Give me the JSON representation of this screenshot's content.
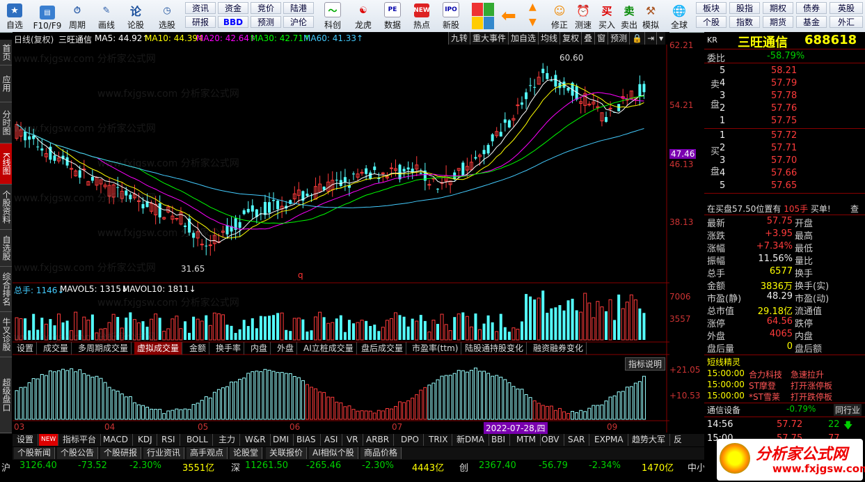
{
  "toolbar": {
    "buttons": [
      {
        "label": "自选",
        "icon": "star-icon"
      },
      {
        "label": "F10/F9",
        "icon": "f10-icon"
      },
      {
        "label": "周期",
        "icon": "period-icon"
      },
      {
        "label": "画线",
        "icon": "draw-line-icon"
      },
      {
        "label": "论股",
        "icon": "discuss-icon"
      },
      {
        "label": "选股",
        "icon": "stock-picker-icon"
      }
    ],
    "grid1": [
      "资讯",
      "资金",
      "竞价",
      "陆港",
      "研报",
      "BBD",
      "预测",
      "沪伦"
    ],
    "buttons2": [
      {
        "label": "科创",
        "icon": "kechuang-icon"
      },
      {
        "label": "龙虎",
        "icon": "dragon-tiger-icon"
      },
      {
        "label": "数据",
        "icon": "pe-data-icon"
      },
      {
        "label": "热点",
        "icon": "hot-icon"
      },
      {
        "label": "新股",
        "icon": "ipo-icon"
      }
    ],
    "buttons3": [
      {
        "label": "修正",
        "icon": "correct-icon"
      },
      {
        "label": "测速",
        "icon": "speed-test-icon"
      },
      {
        "label": "买入",
        "icon": "buy-icon",
        "glyph": "买"
      },
      {
        "label": "卖出",
        "icon": "sell-icon",
        "glyph": "卖"
      },
      {
        "label": "模拟",
        "icon": "simulate-icon"
      },
      {
        "label": "全球",
        "icon": "globe-icon"
      }
    ],
    "grid2": [
      "板块",
      "股指",
      "期权",
      "债券",
      "英股",
      "个股",
      "指数",
      "期货",
      "基金",
      "外汇"
    ]
  },
  "left_tabs": [
    "首页",
    "应用",
    "分时图",
    "K线图",
    "个股资料",
    "自选股",
    "综合排名",
    "牛叉诊股",
    "超级盘口"
  ],
  "chart_header": {
    "period": "日线(复权)",
    "name": "三旺通信",
    "ma5": "MA5: 44.92↑",
    "ma10": "MA10: 44.39↑",
    "ma20": "MA20: 42.64↑",
    "ma30": "MA30: 42.71↑",
    "ma60": "MA60: 41.33↑",
    "right_tabs": [
      "九转",
      "重大事件",
      "加自选",
      "均线",
      "复权",
      "叠",
      "窗",
      "预测"
    ]
  },
  "price_axis": [
    "62.21",
    "54.21",
    "47.46",
    "46.13",
    "38.13"
  ],
  "price_annotations": {
    "high": "60.60",
    "low": "31.65",
    "marker": "q"
  },
  "volume_header": {
    "vol": "总手: 1146↓",
    "mavol5": "MAVOL5: 1315↓",
    "mavol10": "MAVOL10: 1811↓"
  },
  "volume_axis": [
    "7006",
    "3557"
  ],
  "indicator_tabs": [
    "设置",
    "成交量",
    "多周期成交量",
    "虚拟成交量",
    "金额",
    "换手率",
    "内盘",
    "外盘",
    "AI立桩成交量",
    "盘后成交量",
    "市盈率(ttm)",
    "陆股通持股变化",
    "融资融券变化"
  ],
  "indicator_active": "虚拟成交量",
  "indicator_help": "指标说明",
  "indicator_axis": [
    "+21.05",
    "+10.53"
  ],
  "date_axis": [
    "03",
    "04",
    "05",
    "06",
    "07",
    "09"
  ],
  "date_cursor": "2022-07-28,四",
  "bottom_tabs": [
    "设置",
    "NEW",
    "指标平台",
    "MACD",
    "KDJ",
    "RSI",
    "BOLL",
    "主力",
    "W&R",
    "DMI",
    "BIAS",
    "ASI",
    "VR",
    "ARBR",
    "DPO",
    "TRIX",
    "新DMA",
    "BBI",
    "MTM",
    "OBV",
    "SAR",
    "EXPMA",
    "趋势大军",
    "反"
  ],
  "news_tabs": [
    "个股新闻",
    "个股公告",
    "个股研报",
    "行业资讯",
    "高手观点",
    "论股堂",
    "关联报价",
    "AI相似个股",
    "商品价格"
  ],
  "index_bar": {
    "sh": {
      "name": "沪",
      "value": "3126.40",
      "change": "-73.52",
      "pct": "-2.30%",
      "amount": "3551亿"
    },
    "sz": {
      "name": "深",
      "value": "11261.50",
      "change": "-265.46",
      "pct": "-2.30%",
      "amount": "4443亿"
    },
    "cy": {
      "name": "创",
      "value": "2367.40",
      "change": "-56.79",
      "pct": "-2.34%",
      "amount": "1470亿"
    },
    "extra": "中小板"
  },
  "quote": {
    "market": "KR",
    "name": "三旺通信",
    "code": "688618",
    "weibi_label": "委比",
    "weibi": "-58.79%",
    "sell_label": "卖盘",
    "buy_label": "买盘",
    "sells": [
      {
        "lvl": "5",
        "price": "58.21"
      },
      {
        "lvl": "4",
        "price": "57.79"
      },
      {
        "lvl": "3",
        "price": "57.78"
      },
      {
        "lvl": "2",
        "price": "57.76"
      },
      {
        "lvl": "1",
        "price": "57.75"
      }
    ],
    "buys": [
      {
        "lvl": "1",
        "price": "57.72"
      },
      {
        "lvl": "2",
        "price": "57.71"
      },
      {
        "lvl": "3",
        "price": "57.70"
      },
      {
        "lvl": "4",
        "price": "57.66"
      },
      {
        "lvl": "5",
        "price": "57.65"
      }
    ],
    "notice": "在买盘57.50位置有",
    "notice_vol": "105手",
    "notice_tail": "买单!",
    "notice_more": "查",
    "stats": [
      {
        "l": "最新",
        "v": "57.75",
        "c": "red",
        "l2": "开盘"
      },
      {
        "l": "涨跌",
        "v": "+3.95",
        "c": "red",
        "l2": "最高"
      },
      {
        "l": "涨幅",
        "v": "+7.34%",
        "c": "red",
        "l2": "最低"
      },
      {
        "l": "振幅",
        "v": "11.56%",
        "c": "white",
        "l2": "量比"
      },
      {
        "l": "总手",
        "v": "6577",
        "c": "yellow",
        "l2": "换手"
      },
      {
        "l": "金额",
        "v": "3836万",
        "c": "yellow",
        "l2": "换手(实)"
      },
      {
        "l": "市盈(静)",
        "v": "48.29",
        "c": "white",
        "l2": "市盈(动)"
      },
      {
        "l": "总市值",
        "v": "29.18亿",
        "c": "yellow",
        "l2": "流通值"
      },
      {
        "l": "涨停",
        "v": "64.56",
        "c": "red",
        "l2": "跌停"
      },
      {
        "l": "外盘",
        "v": "4065",
        "c": "red",
        "l2": "内盘"
      },
      {
        "l": "盘后量",
        "v": "0",
        "c": "yellow",
        "l2": "盘后额"
      }
    ],
    "sprite_title": "短线精灵",
    "sprites": [
      {
        "time": "15:00:00",
        "name": "合力科技",
        "event": "急速拉升"
      },
      {
        "time": "15:00:00",
        "name": "ST摩登",
        "event": "打开涨停板"
      },
      {
        "time": "15:00:00",
        "name": "*ST雪莱",
        "event": "打开跌停板"
      }
    ],
    "sector": {
      "name": "通信设备",
      "pct": "-0.79%",
      "more": "同行业"
    },
    "ticks": [
      {
        "time": "14:56",
        "price": "57.72",
        "vol": "22"
      },
      {
        "time": "15:00",
        "price": "57.75",
        "vol": "77"
      }
    ]
  },
  "watermark": "www.fxjgsw.com 分析家公式网",
  "logo_text": "分析家公式网",
  "logo_url": "www.fxjgsw.com"
}
